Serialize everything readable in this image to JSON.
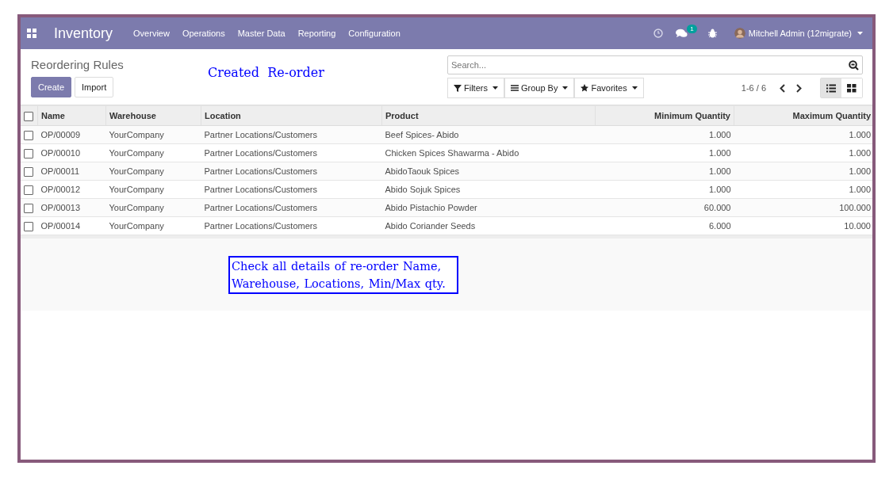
{
  "navbar": {
    "app_title": "Inventory",
    "menu": [
      "Overview",
      "Operations",
      "Master Data",
      "Reporting",
      "Configuration"
    ],
    "messages_badge": "1",
    "user": "Mitchell Admin (12migrate)"
  },
  "control_panel": {
    "title": "Reordering Rules",
    "buttons": [
      {
        "label": "Create",
        "kind": "primary"
      },
      {
        "label": "Import",
        "kind": "secondary"
      }
    ],
    "search": {
      "placeholder": "Search..."
    },
    "filters": [
      {
        "label": "Filters",
        "kind": "filter"
      },
      {
        "label": "Group By",
        "kind": "group"
      },
      {
        "label": "Favorites",
        "kind": "star"
      }
    ],
    "pager": "1-6 / 6",
    "views": [
      {
        "kind": "list",
        "selected": true
      },
      {
        "kind": "kanban",
        "selected": false
      }
    ]
  },
  "table": {
    "columns": [
      {
        "label": "Name",
        "kind": "text"
      },
      {
        "label": "Warehouse",
        "kind": "text"
      },
      {
        "label": "Location",
        "kind": "text"
      },
      {
        "label": "Product",
        "kind": "text"
      },
      {
        "label": "Minimum Quantity",
        "kind": "number"
      },
      {
        "label": "Maximum Quantity",
        "kind": "number"
      }
    ],
    "all_checked": false,
    "rows": [
      {
        "checked": false,
        "cells": [
          "OP/00009",
          "YourCompany",
          "Partner Locations/Customers",
          "Beef Spices- Abido",
          "1.000",
          "1.000"
        ]
      },
      {
        "checked": false,
        "cells": [
          "OP/00010",
          "YourCompany",
          "Partner Locations/Customers",
          "Chicken Spices Shawarma - Abido",
          "1.000",
          "1.000"
        ]
      },
      {
        "checked": false,
        "cells": [
          "OP/00011",
          "YourCompany",
          "Partner Locations/Customers",
          "AbidoTaouk Spices",
          "1.000",
          "1.000"
        ]
      },
      {
        "checked": false,
        "cells": [
          "OP/00012",
          "YourCompany",
          "Partner Locations/Customers",
          "Abido Sojuk Spices",
          "1.000",
          "1.000"
        ]
      },
      {
        "checked": false,
        "cells": [
          "OP/00013",
          "YourCompany",
          "Partner Locations/Customers",
          "Abido Pistachio Powder",
          "60.000",
          "100.000"
        ]
      },
      {
        "checked": false,
        "cells": [
          "OP/00014",
          "YourCompany",
          "Partner Locations/Customers",
          "Abido Coriander Seeds",
          "6.000",
          "10.000"
        ]
      }
    ]
  },
  "annotations": [
    {
      "text": "Created  Re-order",
      "kind": "plain"
    },
    {
      "text": "Check all details of re-order Name, Warehouse, Locations, Min/Max qty.",
      "kind": "boxed"
    }
  ]
}
